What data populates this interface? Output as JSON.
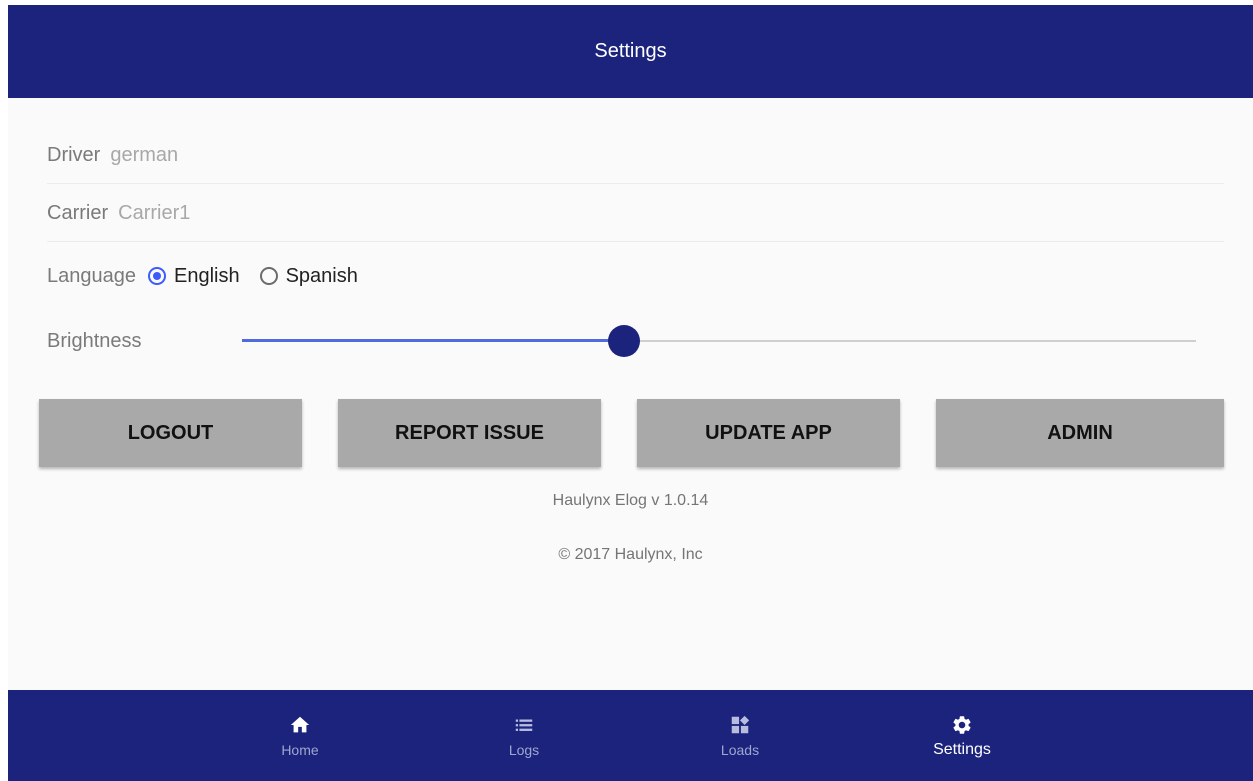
{
  "header": {
    "title": "Settings"
  },
  "profile": {
    "driver_label": "Driver",
    "driver_value": "german",
    "carrier_label": "Carrier",
    "carrier_value": "Carrier1"
  },
  "language": {
    "label": "Language",
    "options": [
      {
        "label": "English",
        "selected": true
      },
      {
        "label": "Spanish",
        "selected": false
      }
    ]
  },
  "brightness": {
    "label": "Brightness",
    "level": 0.4
  },
  "actions": {
    "logout": "LOGOUT",
    "report_issue": "REPORT ISSUE",
    "update_app": "UPDATE APP",
    "admin": "ADMIN"
  },
  "footer": {
    "version": "Haulynx Elog v 1.0.14",
    "copyright": "© 2017 Haulynx, Inc"
  },
  "bottom_nav": {
    "items": [
      {
        "label": "Home",
        "icon": "home-icon",
        "active": false
      },
      {
        "label": "Logs",
        "icon": "list-icon",
        "active": false
      },
      {
        "label": "Loads",
        "icon": "dashboard-icon",
        "active": false
      },
      {
        "label": "Settings",
        "icon": "gear-icon",
        "active": true
      }
    ]
  },
  "colors": {
    "primary": "#1b237c",
    "accent": "#3d5afe",
    "button_bg": "#a9a9a9",
    "background": "#fafafa"
  }
}
